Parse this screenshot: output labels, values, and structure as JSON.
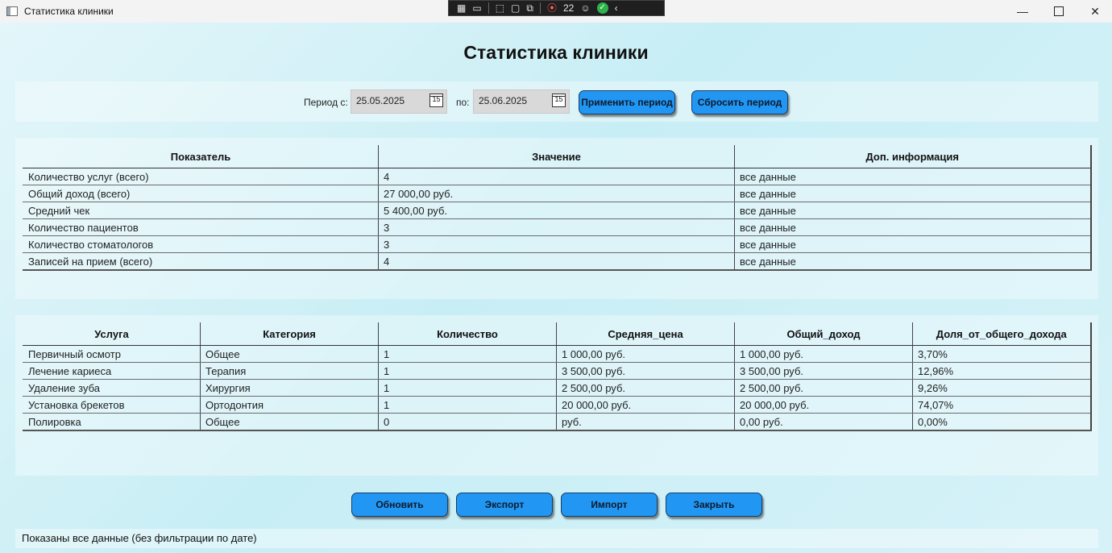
{
  "window": {
    "title": "Статистика клиники",
    "devtools_badge": "22"
  },
  "page_title": "Статистика клиники",
  "filter": {
    "from_label": "Период с:",
    "from_value": "25.05.2025",
    "to_label": "по:",
    "to_value": "25.06.2025",
    "calendar_glyph": "15",
    "apply_label": "Применить период",
    "reset_label": "Сбросить период"
  },
  "summary_table": {
    "headers": [
      "Показатель",
      "Значение",
      "Доп. информация"
    ],
    "rows": [
      [
        "Количество услуг (всего)",
        "4",
        "все данные"
      ],
      [
        "Общий доход (всего)",
        "27 000,00 руб.",
        "все данные"
      ],
      [
        "Средний чек",
        "5 400,00 руб.",
        "все данные"
      ],
      [
        "Количество пациентов",
        "3",
        "все данные"
      ],
      [
        "Количество стоматологов",
        "3",
        "все данные"
      ],
      [
        "Записей на прием (всего)",
        "4",
        "все данные"
      ]
    ]
  },
  "services_table": {
    "headers": [
      "Услуга",
      "Категория",
      "Количество",
      "Средняя_цена",
      "Общий_доход",
      "Доля_от_общего_дохода"
    ],
    "rows": [
      [
        "Первичный осмотр",
        "Общее",
        "1",
        "1 000,00 руб.",
        "1 000,00 руб.",
        "3,70%"
      ],
      [
        "Лечение кариеса",
        "Терапия",
        "1",
        "3 500,00 руб.",
        "3 500,00 руб.",
        "12,96%"
      ],
      [
        "Удаление зуба",
        "Хирургия",
        "1",
        "2 500,00 руб.",
        "2 500,00 руб.",
        "9,26%"
      ],
      [
        "Установка брекетов",
        "Ортодонтия",
        "1",
        "20 000,00 руб.",
        "20 000,00 руб.",
        "74,07%"
      ],
      [
        "Полировка",
        "Общее",
        "0",
        " руб.",
        "0,00 руб.",
        "0,00%"
      ]
    ]
  },
  "actions": {
    "refresh_label": "Обновить",
    "export_label": "Экспорт",
    "import_label": "Импорт",
    "close_label": "Закрыть"
  },
  "status": {
    "text": "Показаны все данные (без фильтрации по дате)"
  }
}
